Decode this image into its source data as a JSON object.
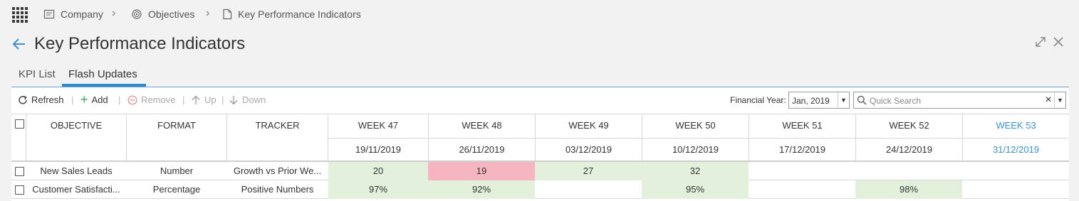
{
  "breadcrumb": {
    "items": [
      {
        "label": "Company",
        "icon": "company-icon"
      },
      {
        "label": "Objectives",
        "icon": "objectives-icon"
      },
      {
        "label": "Key Performance Indicators",
        "icon": "document-icon"
      }
    ]
  },
  "page": {
    "title": "Key Performance Indicators"
  },
  "tabs": [
    {
      "label": "KPI List",
      "active": false
    },
    {
      "label": "Flash Updates",
      "active": true
    }
  ],
  "toolbar": {
    "refresh": "Refresh",
    "add": "Add",
    "remove": "Remove",
    "up": "Up",
    "down": "Down",
    "financial_year_label": "Financial Year:",
    "financial_year_value": "Jan, 2019",
    "search_placeholder": "Quick Search"
  },
  "grid": {
    "columns": {
      "objective": "OBJECTIVE",
      "format": "FORMAT",
      "tracker": "TRACKER"
    },
    "weeks": [
      {
        "label": "WEEK 47",
        "date": "19/11/2019"
      },
      {
        "label": "WEEK 48",
        "date": "26/11/2019"
      },
      {
        "label": "WEEK 49",
        "date": "03/12/2019"
      },
      {
        "label": "WEEK 50",
        "date": "10/12/2019"
      },
      {
        "label": "WEEK 51",
        "date": "17/12/2019"
      },
      {
        "label": "WEEK 52",
        "date": "24/12/2019"
      },
      {
        "label": "WEEK 53",
        "date": "31/12/2019"
      }
    ],
    "rows": [
      {
        "objective": "New Sales Leads",
        "format": "Number",
        "tracker": "Growth vs Prior We...",
        "values": [
          "20",
          "19",
          "27",
          "32",
          "",
          "",
          ""
        ],
        "status": [
          "good",
          "bad",
          "good",
          "good",
          "none",
          "none",
          "none"
        ]
      },
      {
        "objective": "Customer Satisfacti...",
        "format": "Percentage",
        "tracker": "Positive Numbers",
        "values": [
          "97%",
          "92%",
          "",
          "95%",
          "",
          "98%",
          ""
        ],
        "status": [
          "good",
          "good",
          "none",
          "good",
          "none",
          "good",
          "none"
        ]
      }
    ]
  },
  "colors": {
    "accent": "#2f89c8",
    "good": "#e3f1dc",
    "bad": "#f6b6c1",
    "current_week": "#3d8fd1"
  }
}
